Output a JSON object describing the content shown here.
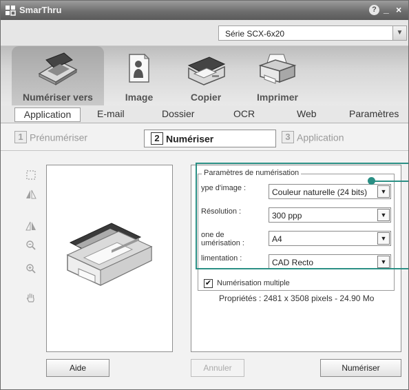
{
  "window": {
    "title": "SmarThru",
    "help": "?",
    "minimize": "_",
    "close": "×"
  },
  "device": {
    "selected": "Série SCX-6x20",
    "arrow": "▼"
  },
  "tools": {
    "scan_to": "Numériser vers",
    "image": "Image",
    "copy": "Copier",
    "print": "Imprimer"
  },
  "subtabs": {
    "application": "Application",
    "email": "E-mail",
    "folder": "Dossier",
    "ocr": "OCR",
    "web": "Web",
    "settings": "Paramètres"
  },
  "steps": [
    {
      "num": "1",
      "label": "Prénumériser"
    },
    {
      "num": "2",
      "label": "Numériser"
    },
    {
      "num": "3",
      "label": "Application"
    }
  ],
  "scan_settings": {
    "group_title": "Paramètres de numérisation",
    "image_type_label": "ype d'image :",
    "image_type_value": "Couleur naturelle (24 bits)",
    "resolution_label": "Résolution :",
    "resolution_value": "300 ppp",
    "zone_label_1": "one de",
    "zone_label_2": "umérisation :",
    "zone_value": "A4",
    "feed_label": "limentation :",
    "feed_value": "CAD Recto",
    "combo_arrow": "▼",
    "multi_scan_label": "Numérisation multiple",
    "multi_scan_checked": true,
    "multi_scan_mark": "✔",
    "properties": "Propriétés : 2481 x 3508 pixels - 24.90 Mo"
  },
  "buttons": {
    "help": "Aide",
    "cancel": "Annuler",
    "scan": "Numériser"
  },
  "colors": {
    "callout": "#2a8f84",
    "titlebar": "#7a7a7a"
  }
}
